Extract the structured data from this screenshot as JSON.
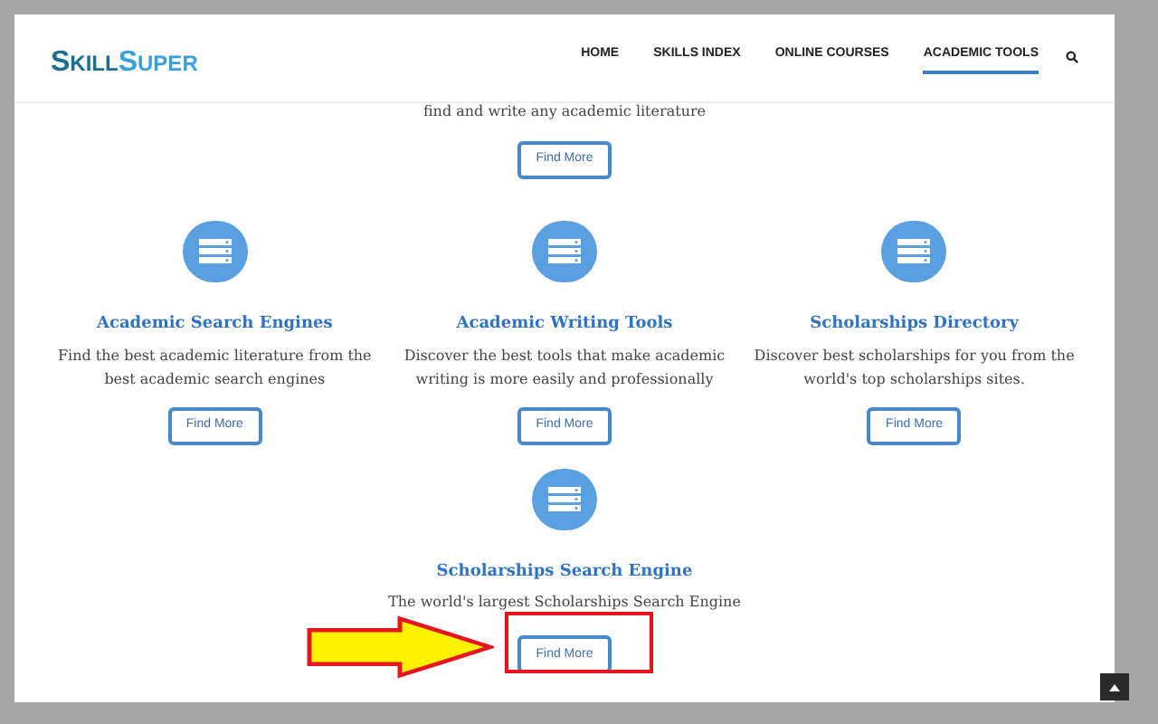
{
  "logo": {
    "first": "SKILL",
    "second": "SUPER"
  },
  "nav": [
    {
      "label": "HOME",
      "selected": false
    },
    {
      "label": "SKILLS INDEX",
      "selected": false
    },
    {
      "label": "ONLINE COURSES",
      "selected": false
    },
    {
      "label": "ACADEMIC TOOLS",
      "selected": true
    }
  ],
  "partial_card": {
    "description": "find and write any academic literature",
    "button": "Find More"
  },
  "cards": [
    {
      "title": "Academic Search Engines",
      "description": "Find the best academic literature from the best academic search engines",
      "button": "Find More"
    },
    {
      "title": "Academic Writing Tools",
      "description": "Discover the best tools that make academic writing is more easily and professionally",
      "button": "Find More"
    },
    {
      "title": "Scholarships Directory",
      "description": "Discover best scholarships for you from the world's top scholarships sites.",
      "button": "Find More"
    }
  ],
  "featured_card": {
    "title": "Scholarships Search Engine",
    "description": "The world's largest Scholarships Search Engine",
    "button": "Find More"
  }
}
